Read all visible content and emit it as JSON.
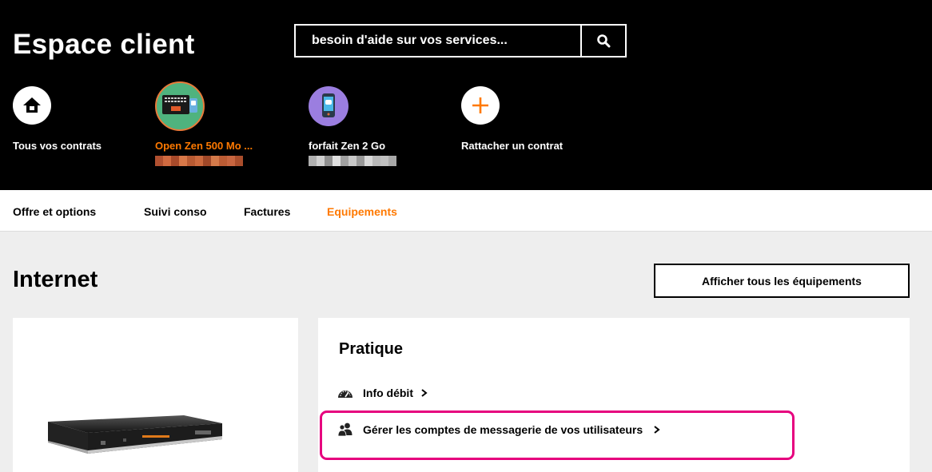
{
  "header": {
    "title": "Espace client",
    "search": {
      "placeholder": "besoin d'aide sur vos services..."
    }
  },
  "contracts": [
    {
      "label": "Tous vos contrats",
      "icon": "home-icon"
    },
    {
      "label": "Open Zen 500 Mo ...",
      "icon": "laptop-phone-icon"
    },
    {
      "label": "forfait Zen 2 Go",
      "icon": "smartphone-icon"
    },
    {
      "label": "Rattacher un contrat",
      "icon": "plus-icon"
    }
  ],
  "tabs": [
    "Offre et options",
    "Suivi conso",
    "Factures",
    "Equipements"
  ],
  "active_tab": "Equipements",
  "main": {
    "section_title": "Internet",
    "all_equipment_button": "Afficher tous les équipements",
    "practical": {
      "title": "Pratique",
      "links": [
        {
          "label": "Info débit",
          "icon": "speedometer-icon"
        },
        {
          "label": "Gérer les comptes de messagerie de vos utilisateurs",
          "icon": "users-icon"
        }
      ]
    }
  },
  "colors": {
    "accent": "#ff7900",
    "header_bg": "#000000",
    "highlight": "#e6007e",
    "page_bg": "#eeeeee"
  }
}
